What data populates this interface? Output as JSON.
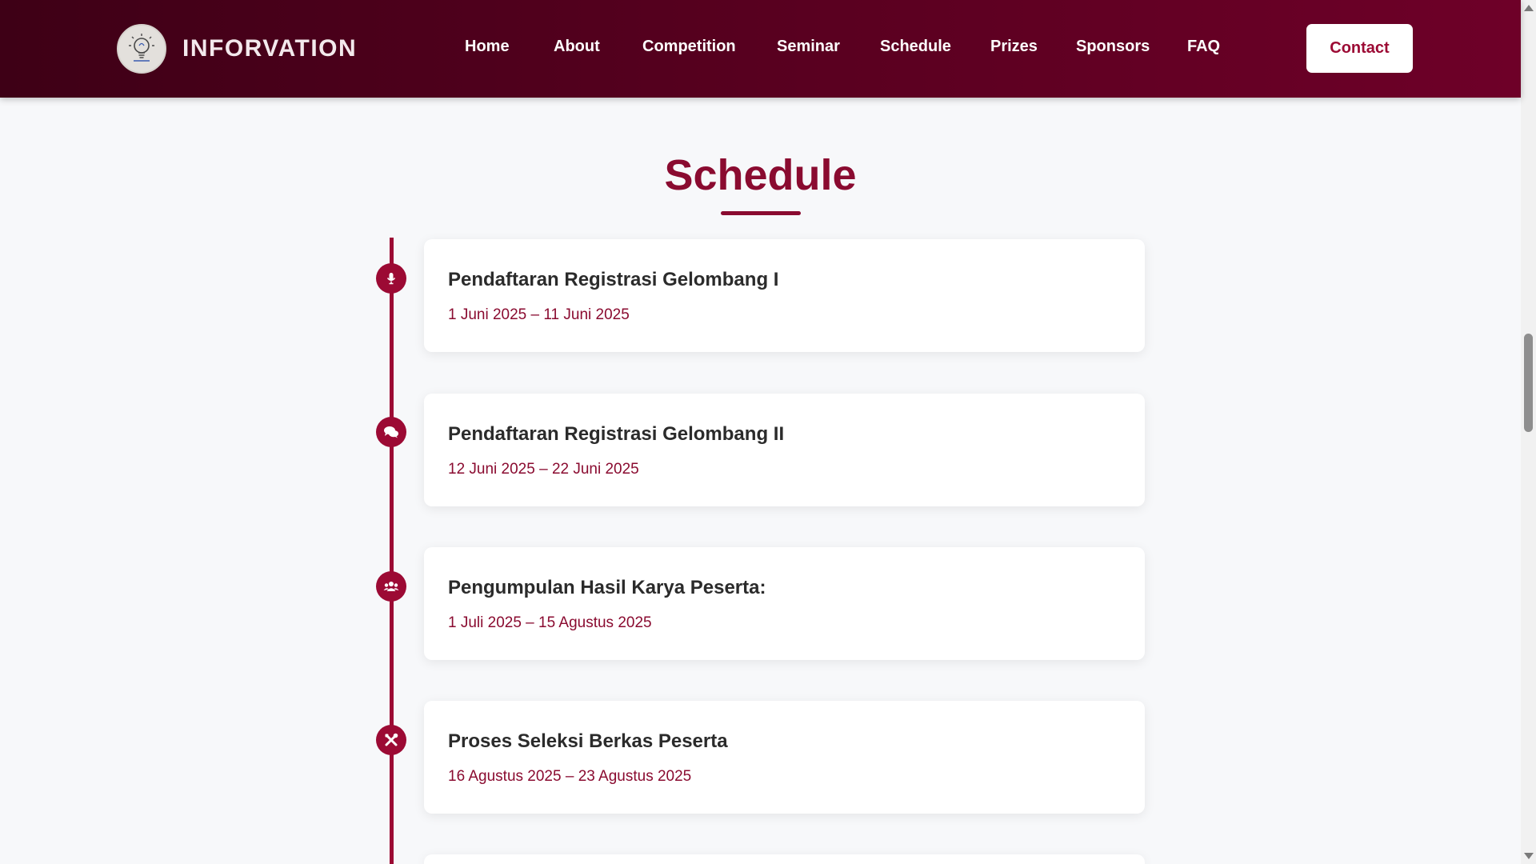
{
  "brand": {
    "name": "INFORVATION",
    "logo_icon": "lightbulb-logo"
  },
  "nav": {
    "items": [
      {
        "label": "Home"
      },
      {
        "label": "About"
      },
      {
        "label": "Competition"
      },
      {
        "label": "Seminar"
      },
      {
        "label": "Schedule"
      },
      {
        "label": "Prizes"
      },
      {
        "label": "Sponsors"
      },
      {
        "label": "FAQ"
      }
    ],
    "contact_label": "Contact"
  },
  "schedule": {
    "title": "Schedule",
    "items": [
      {
        "icon": "microphone-icon",
        "title": "Pendaftaran Registrasi Gelombang I",
        "date": "1 Juni 2025 – 11 Juni 2025"
      },
      {
        "icon": "chat-bubbles-icon",
        "title": "Pendaftaran Registrasi Gelombang II",
        "date": "12 Juni 2025 – 22 Juni 2025"
      },
      {
        "icon": "users-icon",
        "title": "Pengumpulan Hasil Karya Peserta:",
        "date": "1 Juli 2025 – 15 Agustus 2025"
      },
      {
        "icon": "tools-icon",
        "title": "Proses Seleksi Berkas Peserta",
        "date": "16 Agustus 2025 – 23 Agustus 2025"
      }
    ]
  },
  "colors": {
    "header_gradient_start": "#3e0016",
    "header_gradient_end": "#6e0028",
    "accent": "#9c0a34",
    "title": "#8a0b30",
    "page_background": "#f7f8fa"
  }
}
